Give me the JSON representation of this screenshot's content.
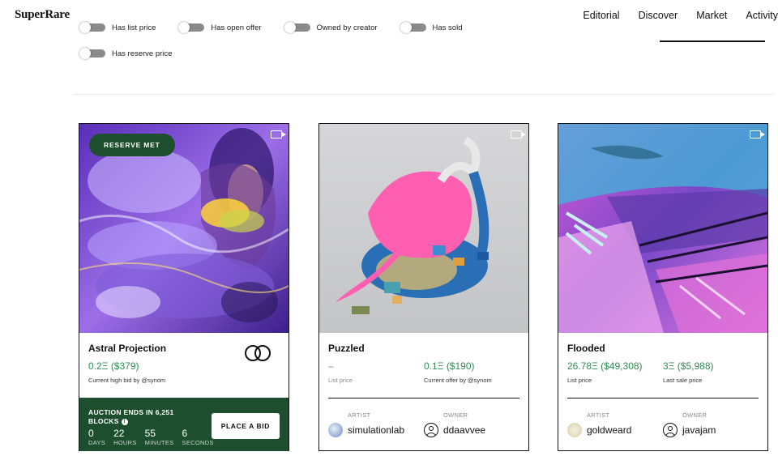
{
  "header": {
    "logo": "SuperRare",
    "nav": [
      "Editorial",
      "Discover",
      "Market",
      "Activity"
    ]
  },
  "filters": {
    "row1": [
      "Has list price",
      "Has open offer",
      "Owned by creator",
      "Has sold"
    ],
    "row2": [
      "Has reserve price"
    ]
  },
  "cards": [
    {
      "title": "Astral Projection",
      "badge": "RESERVE MET",
      "price": "0.2Ξ ($379)",
      "price_label": "Current high bid by @synom",
      "auction_title_1": "AUCTION ENDS IN 6,251",
      "auction_title_2": "BLOCKS",
      "countdown": [
        {
          "num": "0",
          "label": "DAYS"
        },
        {
          "num": "22",
          "label": "HOURS"
        },
        {
          "num": "55",
          "label": "MINUTES"
        },
        {
          "num": "6",
          "label": "SECONDS"
        }
      ],
      "bid_button": "PLACE A BID"
    },
    {
      "title": "Puzzled",
      "list_price": "–",
      "list_price_label": "List price",
      "offer_price": "0.1Ξ ($190)",
      "offer_label": "Current offer by @synom",
      "artist_label": "ARTIST",
      "artist": "simulationlab",
      "owner_label": "OWNER",
      "owner": "ddaavvee"
    },
    {
      "title": "Flooded",
      "list_price": "26.78Ξ ($49,308)",
      "list_price_label": "List price",
      "last_price": "3Ξ ($5,988)",
      "last_label": "Last sale price",
      "artist_label": "ARTIST",
      "artist": "goldweard",
      "owner_label": "OWNER",
      "owner": "javajam"
    }
  ],
  "colors": {
    "accent_green": "#1d4f2e",
    "price_green": "#2f8a55"
  }
}
